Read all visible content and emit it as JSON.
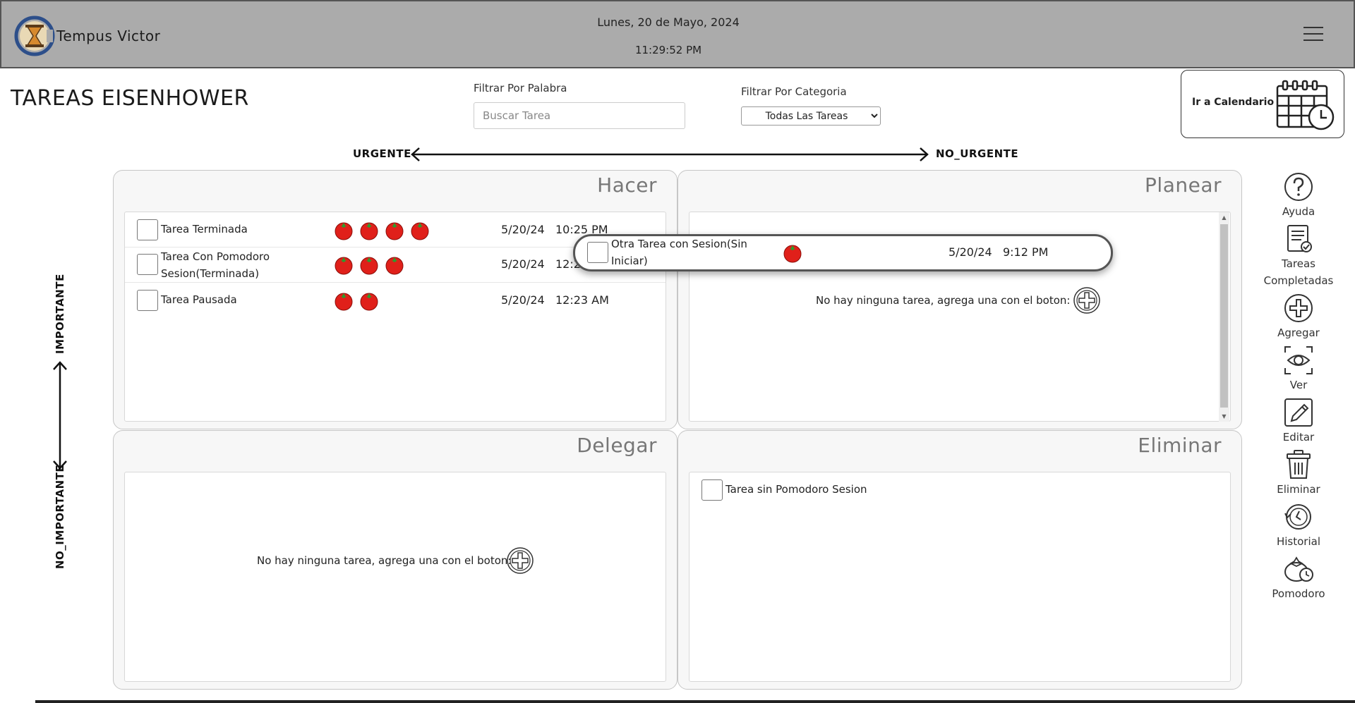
{
  "header": {
    "app_title": "Tempus Victor",
    "date": "Lunes, 20 de Mayo, 2024",
    "time": "11:29:52 PM"
  },
  "page_title": "TAREAS EISENHOWER",
  "filters": {
    "word_label": "Filtrar Por Palabra",
    "word_placeholder": "Buscar Tarea",
    "category_label": "Filtrar Por Categoria",
    "category_selected": "Todas Las Tareas"
  },
  "calendar_button": {
    "label": "Ir a Calendario"
  },
  "axes": {
    "urgent": "URGENTE",
    "not_urgent": "NO_URGENTE",
    "important": "IMPORTANTE",
    "not_important": "NO_IMPORTANTE"
  },
  "quadrants": {
    "do": {
      "title": "Hacer",
      "tasks": [
        {
          "name": "Tarea Terminada",
          "tomatoes": 4,
          "date": "5/20/24",
          "time": "10:25 PM"
        },
        {
          "name": "Tarea Con Pomodoro Sesion(Terminada)",
          "tomatoes": 3,
          "date": "5/20/24",
          "time": "12:23 AM"
        },
        {
          "name": "Tarea Pausada",
          "tomatoes": 2,
          "date": "5/20/24",
          "time": "12:23 AM"
        }
      ]
    },
    "plan": {
      "title": "Planear",
      "empty_message": "No hay ninguna tarea, agrega una con el boton:"
    },
    "delegate": {
      "title": "Delegar",
      "empty_message": "No hay ninguna tarea, agrega una con el boton:"
    },
    "eliminate": {
      "title": "Eliminar",
      "tasks": [
        {
          "name": "Tarea sin Pomodoro Sesion"
        }
      ]
    }
  },
  "dragging_task": {
    "name": "Otra Tarea con Sesion(Sin Iniciar)",
    "tomatoes": 1,
    "date": "5/20/24",
    "time": "9:12 PM"
  },
  "toolbar": [
    {
      "label": "Ayuda",
      "icon": "help-icon"
    },
    {
      "label": "Tareas Completadas",
      "icon": "completed-tasks-icon"
    },
    {
      "label": "Agregar",
      "icon": "add-icon"
    },
    {
      "label": "Ver",
      "icon": "eye-icon"
    },
    {
      "label": "Editar",
      "icon": "edit-icon"
    },
    {
      "label": "Eliminar",
      "icon": "trash-icon"
    },
    {
      "label": "Historial",
      "icon": "history-icon"
    },
    {
      "label": "Pomodoro",
      "icon": "pomodoro-icon"
    }
  ]
}
